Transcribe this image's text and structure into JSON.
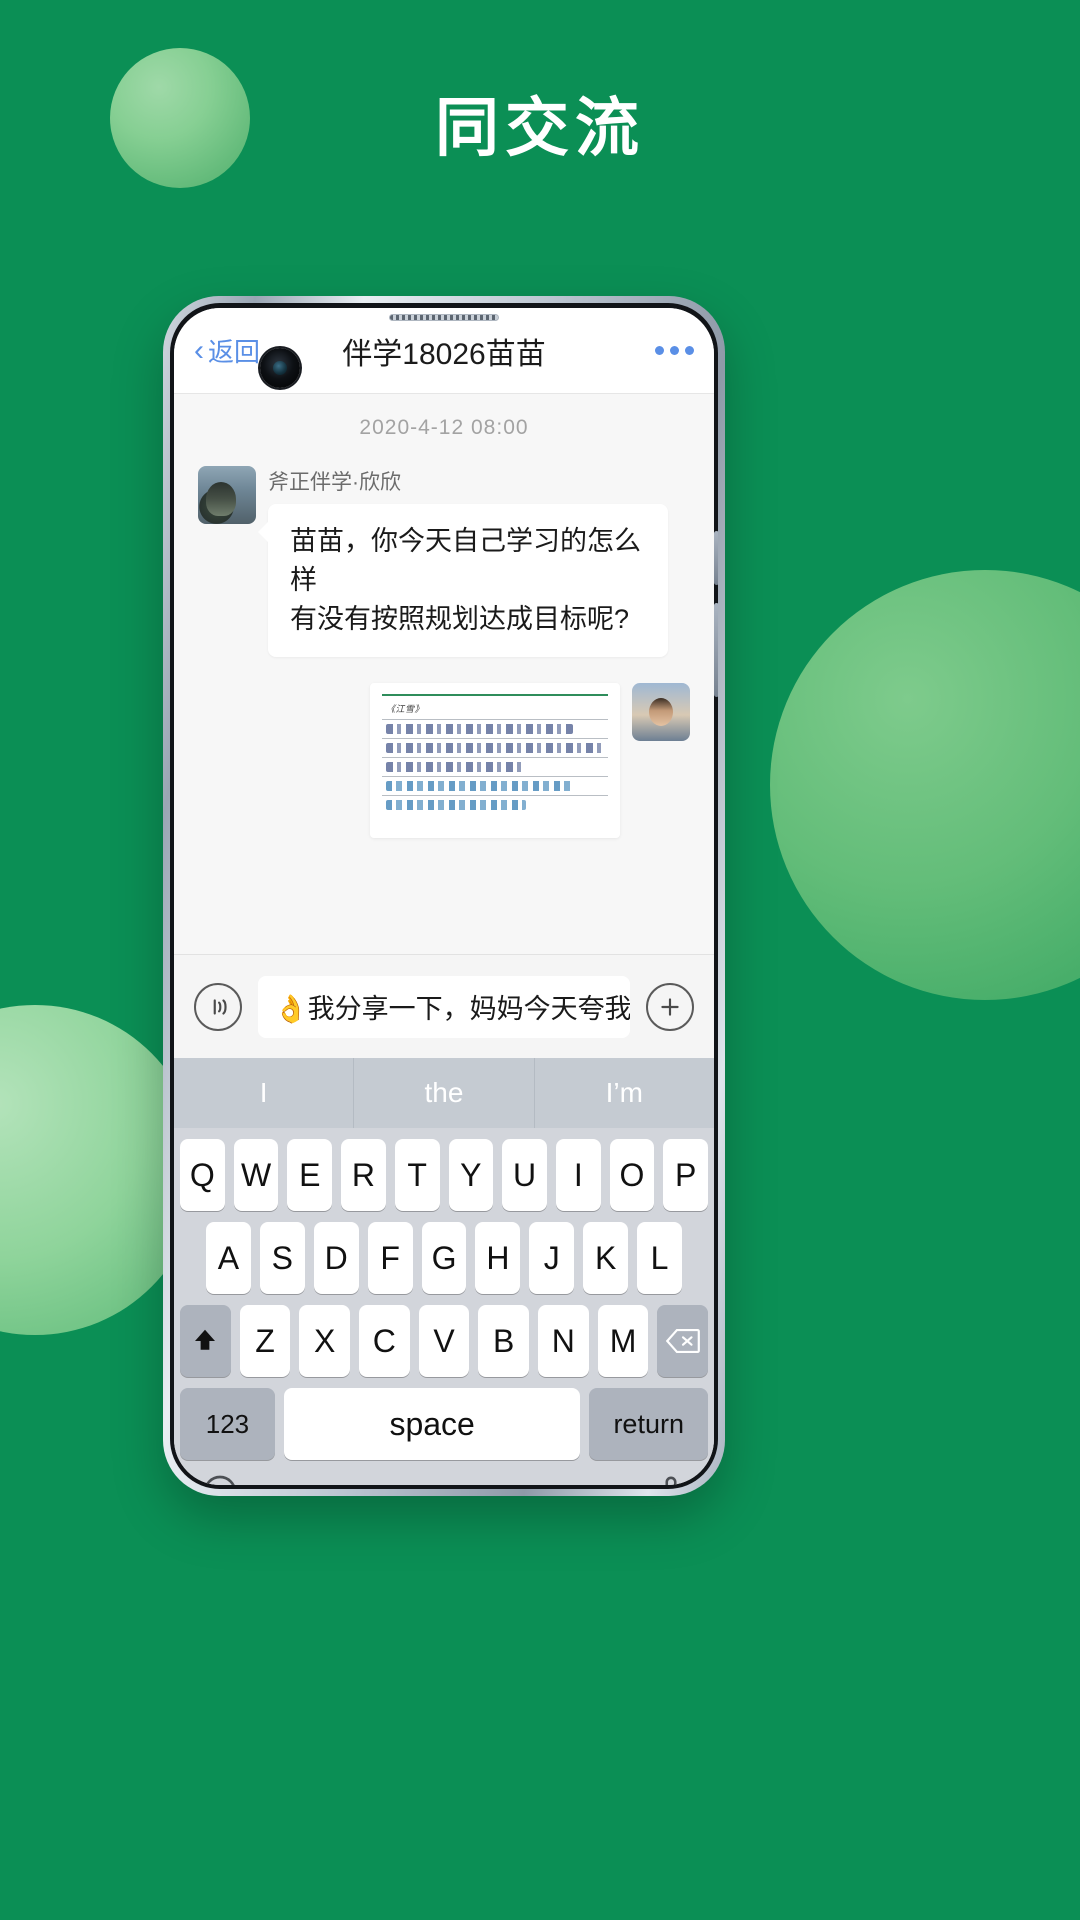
{
  "poster": {
    "headline": "同交流",
    "background_color": "#0b8f55"
  },
  "phone": {
    "navbar": {
      "back_label": "返回",
      "back_chevron": "chevron-left-icon",
      "title": "伴学18026苗苗",
      "more_icon": "more-dots-icon"
    },
    "chat": {
      "timestamp": "2020-4-12  08:00",
      "messages": [
        {
          "side": "left",
          "sender": "斧正伴学·欣欣",
          "text_line1": "苗苗，你今天自己学习的怎么样",
          "text_line2": "有没有按照规划达成目标呢?",
          "avatar": "teacher-avatar"
        },
        {
          "side": "right",
          "type": "image",
          "image_name": "handwritten-homework-note",
          "note_title": "《江雪》",
          "avatar": "student-avatar"
        }
      ]
    },
    "input_bar": {
      "voice_icon": "voice-wave-icon",
      "value": "👌我分享一下，妈妈今天夸我了",
      "placeholder": "",
      "add_icon": "plus-circle-icon"
    },
    "keyboard": {
      "suggestions": [
        "I",
        "the",
        "I’m"
      ],
      "row1": [
        "Q",
        "W",
        "E",
        "R",
        "T",
        "Y",
        "U",
        "I",
        "O",
        "P"
      ],
      "row2": [
        "A",
        "S",
        "D",
        "F",
        "G",
        "H",
        "J",
        "K",
        "L"
      ],
      "row3": [
        "Z",
        "X",
        "C",
        "V",
        "B",
        "N",
        "M"
      ],
      "shift_icon": "shift-up-icon",
      "backspace_icon": "backspace-icon",
      "numeric_label": "123",
      "space_label": "space",
      "return_label": "return",
      "emoji_icon": "emoji-smiley-icon",
      "mic_icon": "microphone-icon"
    }
  }
}
